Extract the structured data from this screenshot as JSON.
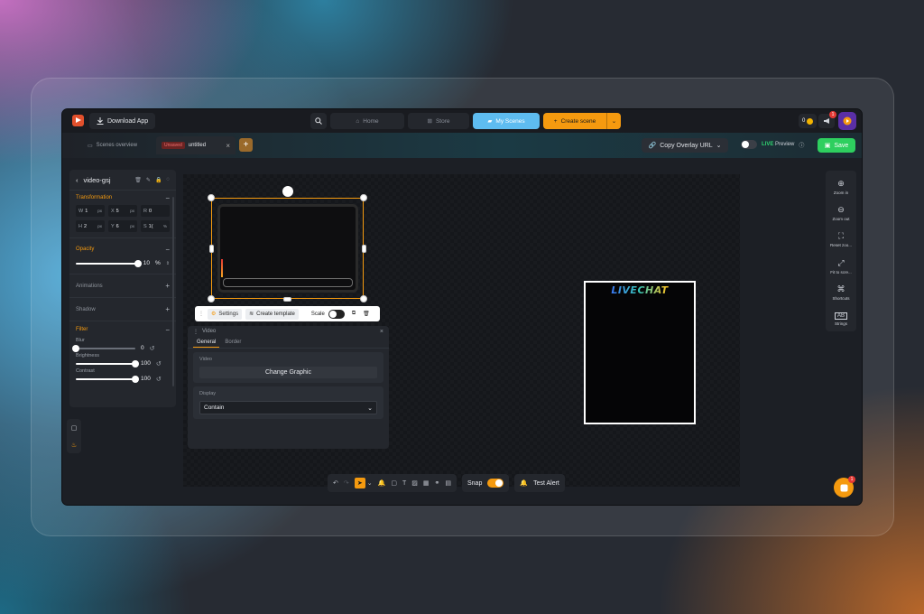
{
  "topbar": {
    "download_label": "Download App",
    "nav": {
      "home": "Home",
      "store": "Store",
      "my_scenes": "My Scenes"
    },
    "create_scene": "Create scene",
    "coins": "0",
    "notif_count": "1"
  },
  "tabbar": {
    "overview": "Scenes overview",
    "unsaved_badge": "Unsaved",
    "untitled": "untitled",
    "copy_url": "Copy Overlay URL",
    "live_word": "LIVE",
    "preview_word": "Preview",
    "save": "Save"
  },
  "left_panel": {
    "element_name": "video-gsj",
    "transformation": {
      "title": "Transformation",
      "fields": [
        {
          "key": "W",
          "value": "1",
          "unit": "px"
        },
        {
          "key": "X",
          "value": "5",
          "unit": "px"
        },
        {
          "key": "R",
          "value": "0",
          "unit": ""
        },
        {
          "key": "H",
          "value": "2",
          "unit": "px"
        },
        {
          "key": "Y",
          "value": "6",
          "unit": "px"
        },
        {
          "key": "S",
          "value": "1(",
          "unit": "%"
        }
      ]
    },
    "opacity": {
      "title": "Opacity",
      "value": "10",
      "unit": "%",
      "fraction": 1.0
    },
    "animations": "Animations",
    "shadow": "Shadow",
    "filter": {
      "title": "Filter",
      "rows": [
        {
          "label": "Blur",
          "value": "0",
          "fraction": 0.0
        },
        {
          "label": "Brightness",
          "value": "100",
          "fraction": 1.0
        },
        {
          "label": "Contrast",
          "value": "100",
          "fraction": 1.0
        }
      ]
    }
  },
  "context_bar": {
    "settings": "Settings",
    "create_template": "Create template",
    "scale": "Scale"
  },
  "video_panel": {
    "title": "Video",
    "tabs": [
      "General",
      "Border"
    ],
    "video_label": "Video",
    "change_graphic": "Change Graphic",
    "display_label": "Display",
    "display_value": "Contain"
  },
  "canvas": {
    "livechat_title": "LIVECHAT"
  },
  "bottom_bar": {
    "snap": "Snap",
    "test_alert": "Test Alert"
  },
  "right_bar": {
    "items": [
      "Zoom in",
      "Zoom out",
      "Reset zoo...",
      "Fit to scre...",
      "Shortcuts",
      "Strings"
    ]
  },
  "chat_badge": "1",
  "colors": {
    "accent": "#f59a0f",
    "scenes_blue": "#5ebcf0",
    "save_green": "#2ecf5f"
  }
}
